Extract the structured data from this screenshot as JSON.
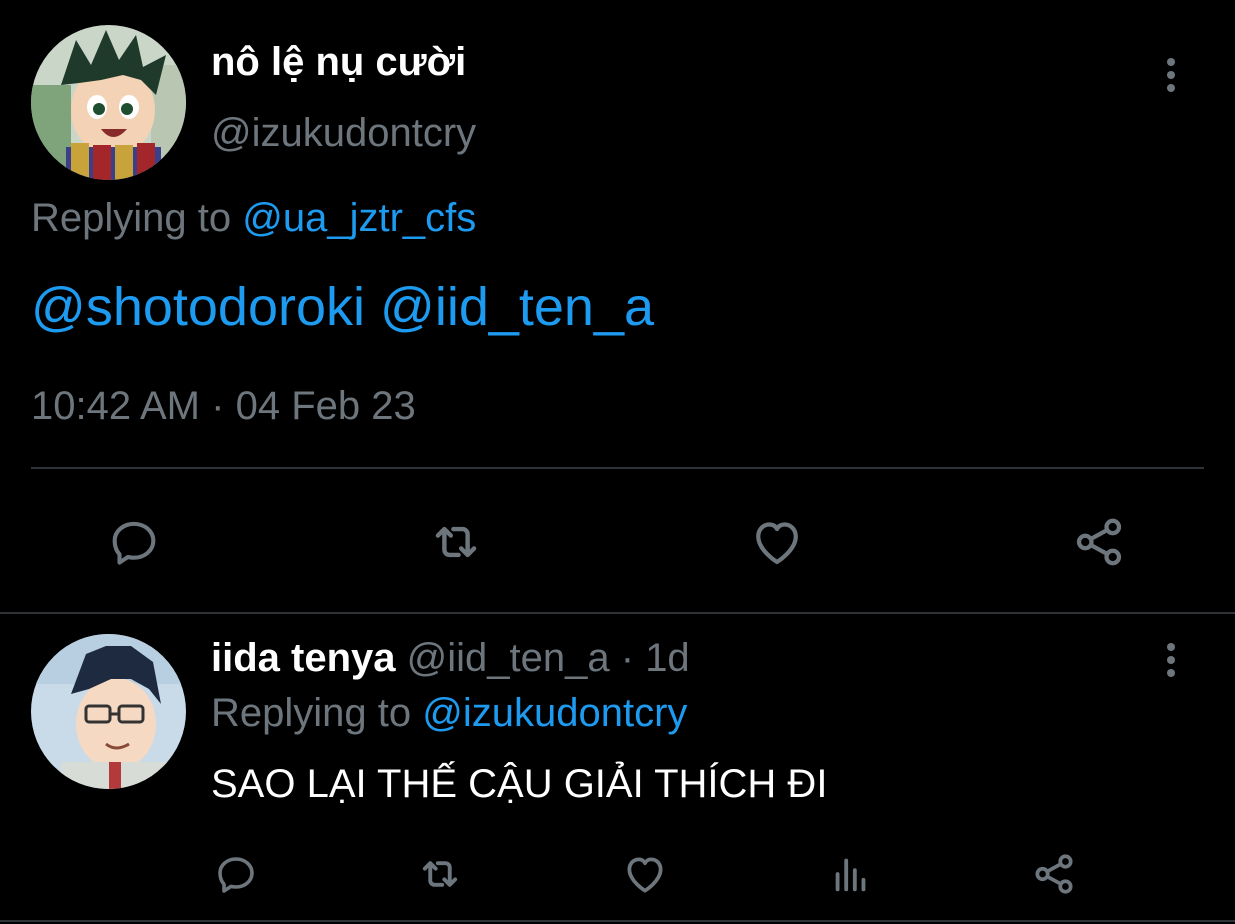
{
  "tweet": {
    "author_name": "nô lệ nụ cười",
    "author_handle": "@izukudontcry",
    "replying_prefix": "Replying to",
    "replying_handle": "@ua_jztr_cfs",
    "body_mention_1": "@shotodoroki",
    "body_mention_2": "@iid_ten_a",
    "time": "10:42 AM",
    "separator": "·",
    "date": "04 Feb 23",
    "actions": [
      "reply-icon",
      "retweet-icon",
      "like-icon",
      "share-icon"
    ]
  },
  "reply": {
    "author_name": "iida tenya",
    "author_handle": "@iid_ten_a",
    "separator": "·",
    "age": "1d",
    "replying_prefix": "Replying to",
    "replying_handle": "@izukudontcry",
    "text": "SAO LẠI THẾ CẬU GIẢI THÍCH ĐI",
    "actions": [
      "reply-icon",
      "retweet-icon",
      "like-icon",
      "analytics-icon",
      "share-icon"
    ]
  },
  "colors": {
    "background": "#000000",
    "text": "#e7e9ea",
    "muted": "#6e767d",
    "link": "#1d9bf0",
    "divider": "#2f3336"
  }
}
